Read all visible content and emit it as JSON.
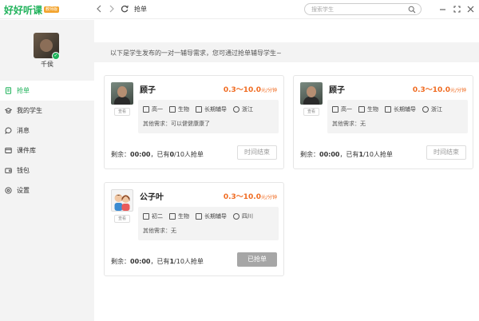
{
  "app": {
    "logo_text": "好好听课",
    "logo_badge": "教师版",
    "page_title": "抢单",
    "search_placeholder": "搜索学生"
  },
  "profile": {
    "name": "千侯"
  },
  "menu": [
    {
      "label": "抢单",
      "icon": "grab-order-icon",
      "active": true
    },
    {
      "label": "我的学生",
      "icon": "students-icon",
      "active": false
    },
    {
      "label": "消息",
      "icon": "message-icon",
      "active": false
    },
    {
      "label": "课件库",
      "icon": "courseware-icon",
      "active": false
    },
    {
      "label": "钱包",
      "icon": "wallet-icon",
      "active": false
    },
    {
      "label": "设置",
      "icon": "settings-icon",
      "active": false
    }
  ],
  "notice": "以下是学生发布的一对一辅导需求，您可通过抢单辅导学生~",
  "cards": [
    {
      "name": "顾子",
      "price_range": "0.3～10.0",
      "price_unit": "元/分钟",
      "tag": "查看",
      "grade": "高一",
      "subject": "生物",
      "duration": "长期辅导",
      "region": "浙江",
      "need": "其他需求：可以健健康康了",
      "remain_label": "剩余：",
      "remain_time": "00:00",
      "taken_prefix": "，已有",
      "taken_count": "0",
      "taken_suffix": "/10人抢单",
      "button": "时间结束"
    },
    {
      "name": "顾子",
      "price_range": "0.3～10.0",
      "price_unit": "元/分钟",
      "tag": "查看",
      "grade": "高一",
      "subject": "生物",
      "duration": "长期辅导",
      "region": "浙江",
      "need": "其他需求：无",
      "remain_label": "剩余：",
      "remain_time": "00:00",
      "taken_prefix": "，已有",
      "taken_count": "1",
      "taken_suffix": "/10人抢单",
      "button": "时间结束"
    },
    {
      "name": "公子叶",
      "price_range": "0.3～10.0",
      "price_unit": "元/分钟",
      "tag": "查看",
      "grade": "初二",
      "subject": "生物",
      "duration": "长期辅导",
      "region": "四川",
      "need": "其他需求：无",
      "remain_label": "剩余：",
      "remain_time": "00:00",
      "taken_prefix": "，已有",
      "taken_count": "1",
      "taken_suffix": "/10人抢单",
      "button": "已抢单"
    }
  ],
  "colors": {
    "brand": "#1fb25a",
    "price": "#f06b21",
    "badge": "#f3a32c"
  }
}
